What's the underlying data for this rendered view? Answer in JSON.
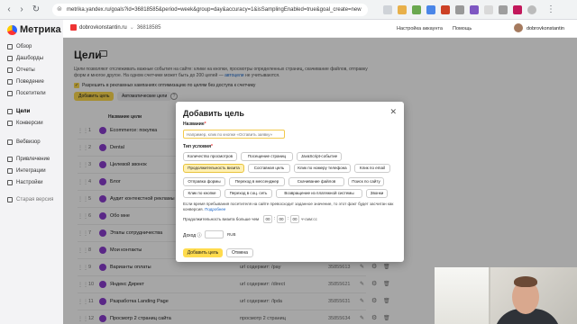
{
  "browser": {
    "url": "metrika.yandex.ru/goals?id=36818585&period=week&group=day&accuracy=1&isSamplingEnabled=true&goal_create=new"
  },
  "app": {
    "logo": "Метрика"
  },
  "topbar": {
    "counter_name": "dobrovkonstantin.ru",
    "counter_id": "36818585",
    "settings": "Настройка аккаунта",
    "help": "Помощь",
    "user": "dobrovkonstantin"
  },
  "sidebar": {
    "items": [
      {
        "label": "Обзор"
      },
      {
        "label": "Дашборды"
      },
      {
        "label": "Отчеты"
      },
      {
        "label": "Поведение"
      },
      {
        "label": "Посетители"
      },
      {
        "label": "Цели"
      },
      {
        "label": "Конверсии"
      },
      {
        "label": "Вебвизор"
      },
      {
        "label": "Привлечение"
      },
      {
        "label": "Интеграции"
      },
      {
        "label": "Настройки"
      },
      {
        "label": "Старая версия"
      }
    ]
  },
  "main": {
    "title": "Цели",
    "intro_1": "Цели позволяют отслеживать важные события на сайте: клики на кнопки, просмотры определенных страниц, скачивание файлов,",
    "intro_2": "отправку форм и многое другое. На одном счетчике может быть до 200 целей —",
    "intro_link": "автоцели",
    "intro_3": "не учитываются.",
    "checkbox_label": "Разрешить в рекламных кампаниях оптимизацию по целям без доступа к счетчику",
    "add_goal": "Добавить цель",
    "auto_goals": "Автоматические цели",
    "col_name": "Название цели",
    "rows": [
      {
        "num": "1",
        "name": "Ecommerce: покупка",
        "cond": "",
        "id": ""
      },
      {
        "num": "2",
        "name": "Dental",
        "cond": "",
        "id": ""
      },
      {
        "num": "3",
        "name": "Целевой звонок",
        "cond": "",
        "id": ""
      },
      {
        "num": "4",
        "name": "Блог",
        "cond": "",
        "id": ""
      },
      {
        "num": "5",
        "name": "Аудит контекстной рекламы",
        "cond": "",
        "id": ""
      },
      {
        "num": "6",
        "name": "Обо мне",
        "cond": "",
        "id": ""
      },
      {
        "num": "7",
        "name": "Этапы сотрудничества",
        "cond": "",
        "id": ""
      },
      {
        "num": "8",
        "name": "Мои контакты",
        "cond": "",
        "id": ""
      },
      {
        "num": "9",
        "name": "Варианты оплаты",
        "cond": "url содержит: /pay",
        "id": "35855613"
      },
      {
        "num": "10",
        "name": "Яндекс Директ",
        "cond": "url содержит: /direct",
        "id": "35855621"
      },
      {
        "num": "11",
        "name": "Разработка Landing Page",
        "cond": "url содержит: /lpda",
        "id": "35855631"
      },
      {
        "num": "12",
        "name": "Просмотр 2 страниц сайта",
        "cond": "просмотр 2 страниц",
        "id": "35855634"
      }
    ]
  },
  "modal": {
    "title": "Добавить цель",
    "name_label": "Название",
    "name_placeholder": "Например, клик по кнопке «Оставить заявку»",
    "type_label": "Тип условия",
    "chips": [
      {
        "label": "Количество просмотров"
      },
      {
        "label": "Посещение страниц"
      },
      {
        "label": "JavaScript-событие"
      },
      {
        "label": "Продолжительность визита"
      },
      {
        "label": "Составная цель"
      },
      {
        "label": "Клик по номеру телефона"
      },
      {
        "label": "Клик по email"
      },
      {
        "label": "Отправка формы"
      },
      {
        "label": "Переход в мессенджер"
      },
      {
        "label": "Скачивание файлов"
      },
      {
        "label": "Поиск по сайту"
      },
      {
        "label": "Клик по кнопке"
      },
      {
        "label": "Переход в соц. сеть"
      },
      {
        "label": "Возвращение из платежной системы"
      },
      {
        "label": "Звонки"
      }
    ],
    "selected_chip": "Продолжительность визита",
    "note": "Если время пребывания посетителя на сайте превосходит заданное значение, то этот факт будет засчитан как конверсия.",
    "note_link": "Подробнее",
    "duration_label": "Продолжительность визита больше чем",
    "hh": "00",
    "mm": "00",
    "ss": "00",
    "time_format": "чч:мм:сс",
    "income_label": "Доход",
    "currency": "RUB",
    "submit": "Добавить цель",
    "cancel": "Отмена"
  }
}
